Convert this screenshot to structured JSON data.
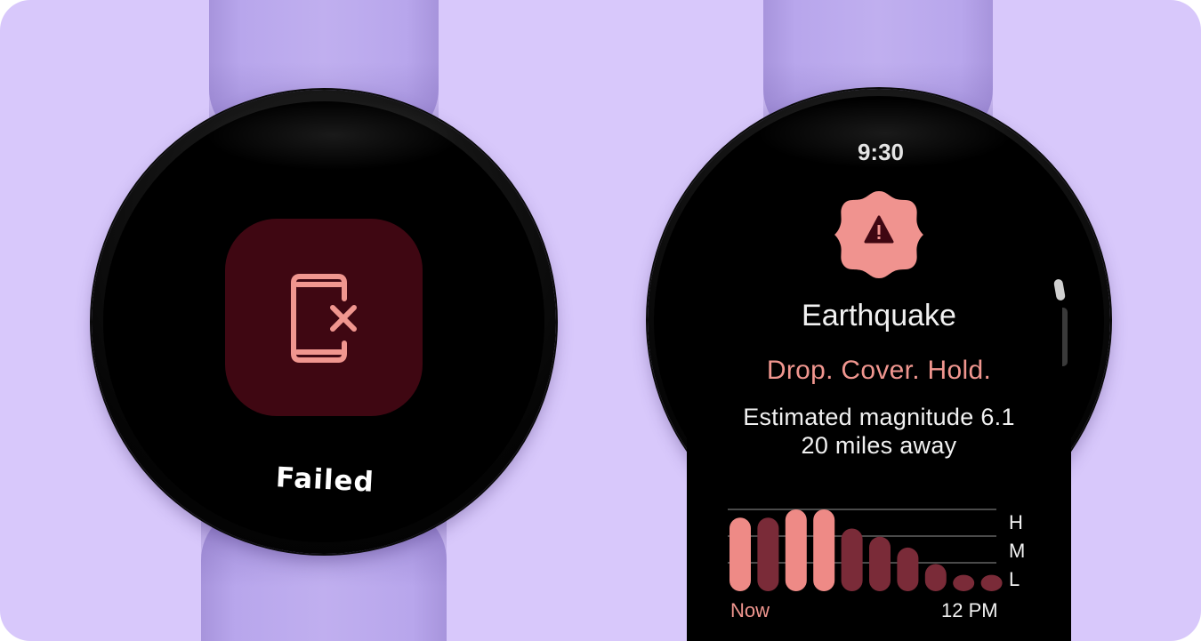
{
  "colors": {
    "background": "#d8c8fb",
    "strap": "#bfaeef",
    "fail_tile": "#3f0712",
    "fail_icon": "#f0968f",
    "alert_badge": "#f0938f",
    "accent_text": "#f0968f",
    "bar_primary": "#ee8a86",
    "bar_secondary": "#7a2b38"
  },
  "watch_left": {
    "icon": "phone-error-icon",
    "status_label": "Failed"
  },
  "watch_right": {
    "time": "9:30",
    "alert_icon": "warning-icon",
    "title": "Earthquake",
    "instruction": "Drop. Cover. Hold.",
    "magnitude_line": "Estimated magnitude 6.1",
    "distance_line": "20 miles away"
  },
  "chart_data": {
    "type": "bar",
    "x": [
      "Now",
      "",
      "",
      "",
      "",
      "",
      "",
      "",
      "",
      "12 PM"
    ],
    "xtick_labels": [
      "Now",
      "12 PM"
    ],
    "y_levels": [
      "L",
      "M",
      "H"
    ],
    "ylim": [
      0,
      3
    ],
    "values": [
      2.7,
      2.7,
      3.0,
      3.0,
      2.3,
      2.0,
      1.6,
      1.0,
      0.6,
      0.6
    ],
    "highlight": [
      true,
      false,
      true,
      true,
      false,
      false,
      false,
      false,
      false,
      false
    ],
    "grid": true
  }
}
